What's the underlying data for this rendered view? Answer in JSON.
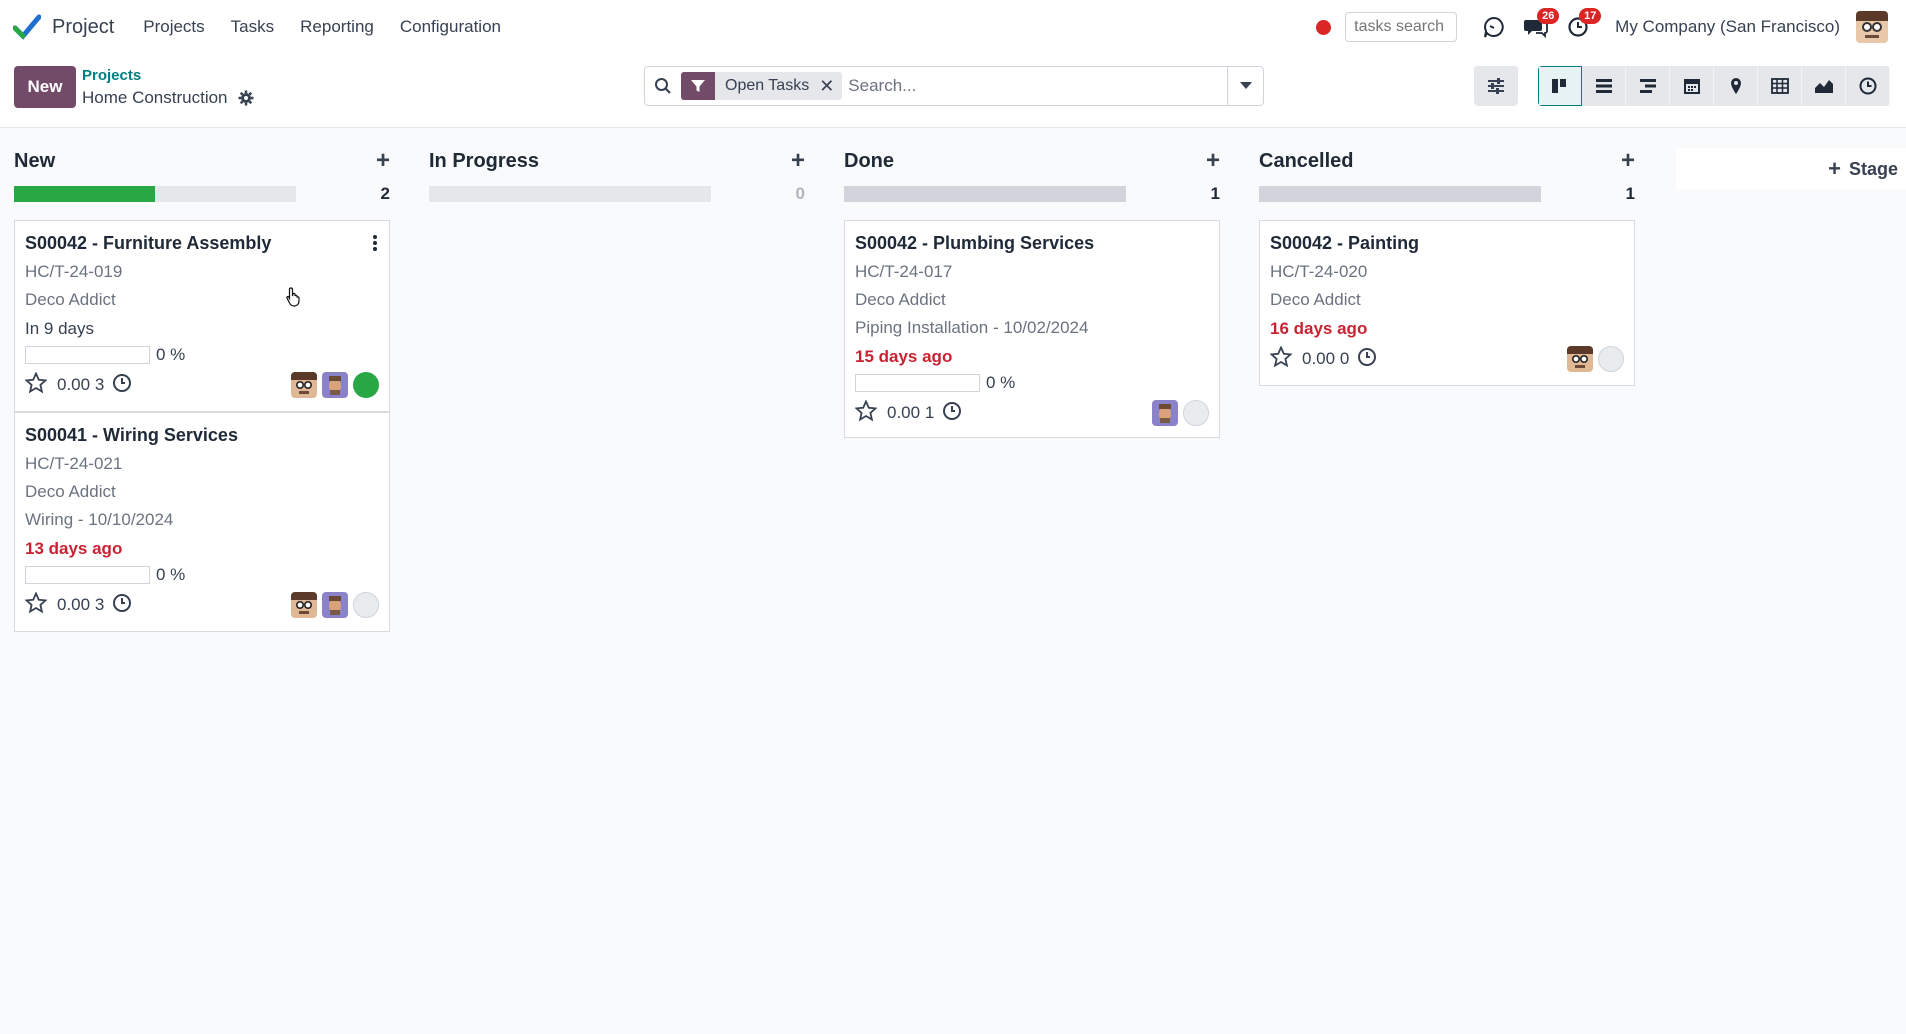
{
  "app": {
    "name": "Project"
  },
  "menu": [
    "Projects",
    "Tasks",
    "Reporting",
    "Configuration"
  ],
  "systray": {
    "tasks_search_placeholder": "tasks search",
    "messages_badge": "26",
    "activities_badge": "17",
    "company": "My Company (San Francisco)"
  },
  "control": {
    "new_label": "New",
    "breadcrumb_parent": "Projects",
    "breadcrumb_current": "Home Construction"
  },
  "search": {
    "facet_label": "Open Tasks",
    "placeholder": "Search..."
  },
  "views": [
    "kanban",
    "list",
    "gantt",
    "calendar",
    "map",
    "pivot",
    "graph",
    "activity"
  ],
  "kanban": {
    "add_stage_label": "Stage",
    "columns": [
      {
        "title": "New",
        "count": "2",
        "progress": 0.5,
        "cards": [
          {
            "title": "S00042 - Furniture Assembly",
            "ref": "HC/T-24-019",
            "customer": "Deco Addict",
            "date": "In 9 days",
            "progress": "0 %",
            "hours": "0.00",
            "subtasks": "3",
            "status": "green"
          },
          {
            "title": "S00041 - Wiring Services",
            "ref": "HC/T-24-021",
            "customer": "Deco Addict",
            "milestone": "Wiring - 10/10/2024",
            "date": "13 days ago",
            "progress": "0 %",
            "hours": "0.00",
            "subtasks": "3",
            "status": "grey"
          }
        ]
      },
      {
        "title": "In Progress",
        "count": "0",
        "progress": 0,
        "cards": []
      },
      {
        "title": "Done",
        "count": "1",
        "progress": 0,
        "cards": [
          {
            "title": "S00042 - Plumbing Services",
            "ref": "HC/T-24-017",
            "customer": "Deco Addict",
            "milestone": "Piping Installation - 10/02/2024",
            "date": "15 days ago",
            "progress": "0 %",
            "hours": "0.00",
            "subtasks": "1",
            "status": "grey"
          }
        ]
      },
      {
        "title": "Cancelled",
        "count": "1",
        "progress": 0,
        "cards": [
          {
            "title": "S00042 - Painting",
            "ref": "HC/T-24-020",
            "customer": "Deco Addict",
            "date": "16 days ago",
            "hours": "0.00",
            "subtasks": "0",
            "status": "grey"
          }
        ]
      }
    ]
  },
  "colors": {
    "brand": "#714b67",
    "accent": "#017e84",
    "late": "#c82333",
    "done_green": "#28a745"
  }
}
